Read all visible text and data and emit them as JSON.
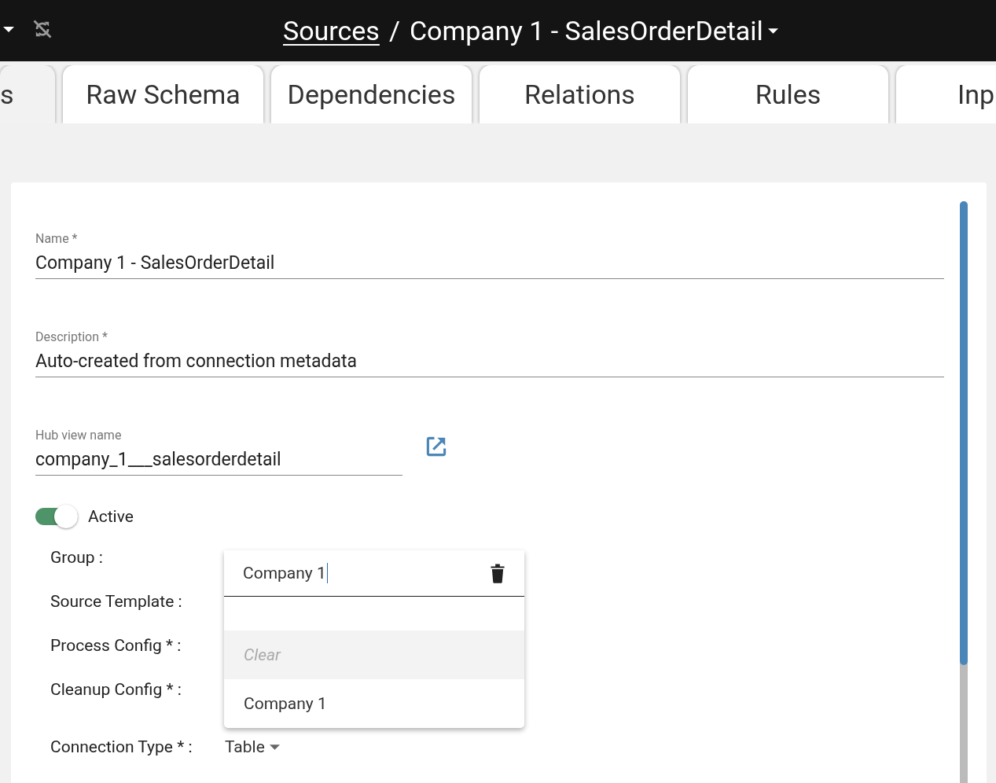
{
  "header": {
    "breadcrumb_link": "Sources",
    "separator": "/",
    "title": "Company 1 - SalesOrderDetail"
  },
  "tabs": [
    {
      "label": "s",
      "selected": true
    },
    {
      "label": "Raw Schema",
      "selected": false
    },
    {
      "label": "Dependencies",
      "selected": false
    },
    {
      "label": "Relations",
      "selected": false
    },
    {
      "label": "Rules",
      "selected": false
    },
    {
      "label": "Inp",
      "selected": false
    }
  ],
  "fields": [
    {
      "label": "Name *",
      "value": "Company 1 - SalesOrderDetail",
      "kind": "full"
    },
    {
      "label": "Description *",
      "value": "Auto-created from connection metadata",
      "kind": "full"
    },
    {
      "label": "Hub view name",
      "value": "company_1___salesorderdetail",
      "kind": "link"
    }
  ],
  "active_toggle": {
    "label": "Active",
    "on": true
  },
  "form_rows": [
    {
      "label": "Group :"
    },
    {
      "label": "Source Template :"
    },
    {
      "label": "Process Config * :"
    },
    {
      "label": "Cleanup Config * :"
    },
    {
      "label": "Connection Type * :",
      "value": "Table"
    }
  ],
  "dropdown": {
    "query": "Company 1",
    "options": [
      {
        "label": "Clear",
        "kind": "clear",
        "selected": true
      },
      {
        "label": "Company 1",
        "kind": "option",
        "selected": false
      }
    ]
  }
}
